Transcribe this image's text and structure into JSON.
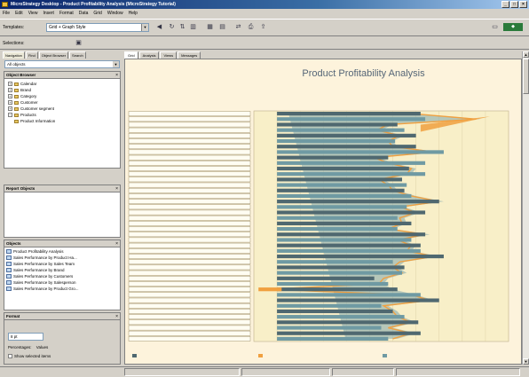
{
  "window": {
    "title": "MicroStrategy Desktop - Product Profitability Analysis (MicroStrategy Tutorial)",
    "controls": [
      "_",
      "□",
      "×"
    ]
  },
  "menu": [
    "File",
    "Edit",
    "View",
    "Insert",
    "Format",
    "Data",
    "Grid",
    "Window",
    "Help"
  ],
  "toolbar": {
    "template_label": "Templates:",
    "template_value": "Grid + Graph Style",
    "selection_label": "Selections:",
    "icons": [
      "back-icon",
      "refresh-icon",
      "sort-icon",
      "chart-icon",
      "grid-icon",
      "graph-icon",
      "pivot-icon",
      "print-icon",
      "export-icon"
    ]
  },
  "left_pane": {
    "tabs": [
      "Navigation",
      "Find",
      "Object Browser",
      "Search"
    ],
    "dropdown": "All objects",
    "object_browser": {
      "title": "Object Browser",
      "items": [
        {
          "label": "Calendar",
          "expanded": false
        },
        {
          "label": "Brand",
          "expanded": false
        },
        {
          "label": "Category",
          "expanded": false
        },
        {
          "label": "Customer",
          "expanded": false
        },
        {
          "label": "Customer segment",
          "expanded": false
        },
        {
          "label": "Products",
          "expanded": true
        },
        {
          "label": "Product Information",
          "expanded": false
        }
      ]
    },
    "report_objects": {
      "title": "Report Objects"
    },
    "objects_panel": {
      "title": "Objects",
      "items": [
        "Product Profitability Analysis",
        "Sales Performance by Product Ha...",
        "Sales Performance by Sales Team",
        "Sales Performance by Brand",
        "Sales Performance by Customers",
        "Sales Performance by Salesperson",
        "Sales Performance by Product Gro..."
      ]
    },
    "format_panel": {
      "title": "Format",
      "font_size": "8 pt",
      "percentages_label": "Percentages:",
      "percentages_value": "Values",
      "checkbox_label": "Show selected items"
    }
  },
  "main_tabs": [
    "Grid",
    "Analysis",
    "Views",
    "Messages"
  ],
  "chart_data": {
    "type": "bar",
    "title": "Product Profitability Analysis",
    "subtitle": "",
    "categories": [
      "",
      "",
      "",
      "",
      "",
      "",
      "",
      "",
      "",
      "",
      "",
      "",
      "",
      "",
      "",
      "",
      "",
      "",
      "",
      "",
      "",
      "",
      "",
      "",
      "",
      "",
      "",
      "",
      "",
      "",
      "",
      "",
      "",
      "",
      "",
      "",
      "",
      "",
      "",
      "",
      "",
      ""
    ],
    "series": [
      {
        "name": "",
        "values": [
          62,
          64,
          52,
          55,
          60,
          51,
          60,
          72,
          48,
          64,
          57,
          64,
          54,
          56,
          55,
          58,
          70,
          56,
          64,
          52,
          58,
          52,
          64,
          58,
          62,
          62,
          72,
          50,
          55,
          54,
          42,
          48,
          52,
          62,
          70,
          45,
          50,
          55,
          61,
          45,
          62,
          48
        ]
      },
      {
        "name": "",
        "values": [
          60,
          88,
          50,
          45,
          55,
          50,
          52,
          70,
          44,
          50,
          60,
          58,
          46,
          50,
          52,
          60,
          72,
          55,
          62,
          55,
          56,
          50,
          66,
          54,
          60,
          58,
          70,
          55,
          52,
          56,
          48,
          46,
          50,
          60,
          68,
          48,
          52,
          54,
          60,
          50,
          60,
          52
        ]
      },
      {
        "name": "",
        "values": [
          58,
          86,
          48,
          43,
          53,
          48,
          50,
          68,
          42,
          48,
          58,
          56,
          44,
          48,
          50,
          58,
          70,
          53,
          60,
          53,
          54,
          48,
          64,
          52,
          58,
          56,
          68,
          53,
          50,
          54,
          46,
          44,
          -5,
          58,
          66,
          46,
          50,
          52,
          58,
          48,
          58,
          50
        ]
      }
    ],
    "xlim": [
      -10,
      100
    ],
    "ticks": [
      "",
      "",
      "",
      "",
      "",
      "",
      "",
      "",
      "",
      "",
      "",
      ""
    ],
    "legend": [
      "",
      "",
      ""
    ],
    "row_labels": [
      "",
      "",
      "",
      "",
      "",
      "",
      "",
      "",
      "",
      "",
      "",
      "",
      "",
      "",
      "",
      "",
      "",
      "",
      "",
      "",
      "",
      "",
      "",
      "",
      "",
      "",
      "",
      "",
      "",
      "",
      "",
      "",
      "",
      "",
      "",
      "",
      "",
      "",
      "",
      "",
      "",
      ""
    ],
    "colors": {
      "bar_main": "#4f6870",
      "bar_alt": "#6f9aa3",
      "area": "#f0a040",
      "area_fill": "#7fa5ad",
      "background": "#fdf3dc"
    }
  },
  "status": {
    "cells": [
      "",
      "",
      "",
      "",
      ""
    ]
  }
}
